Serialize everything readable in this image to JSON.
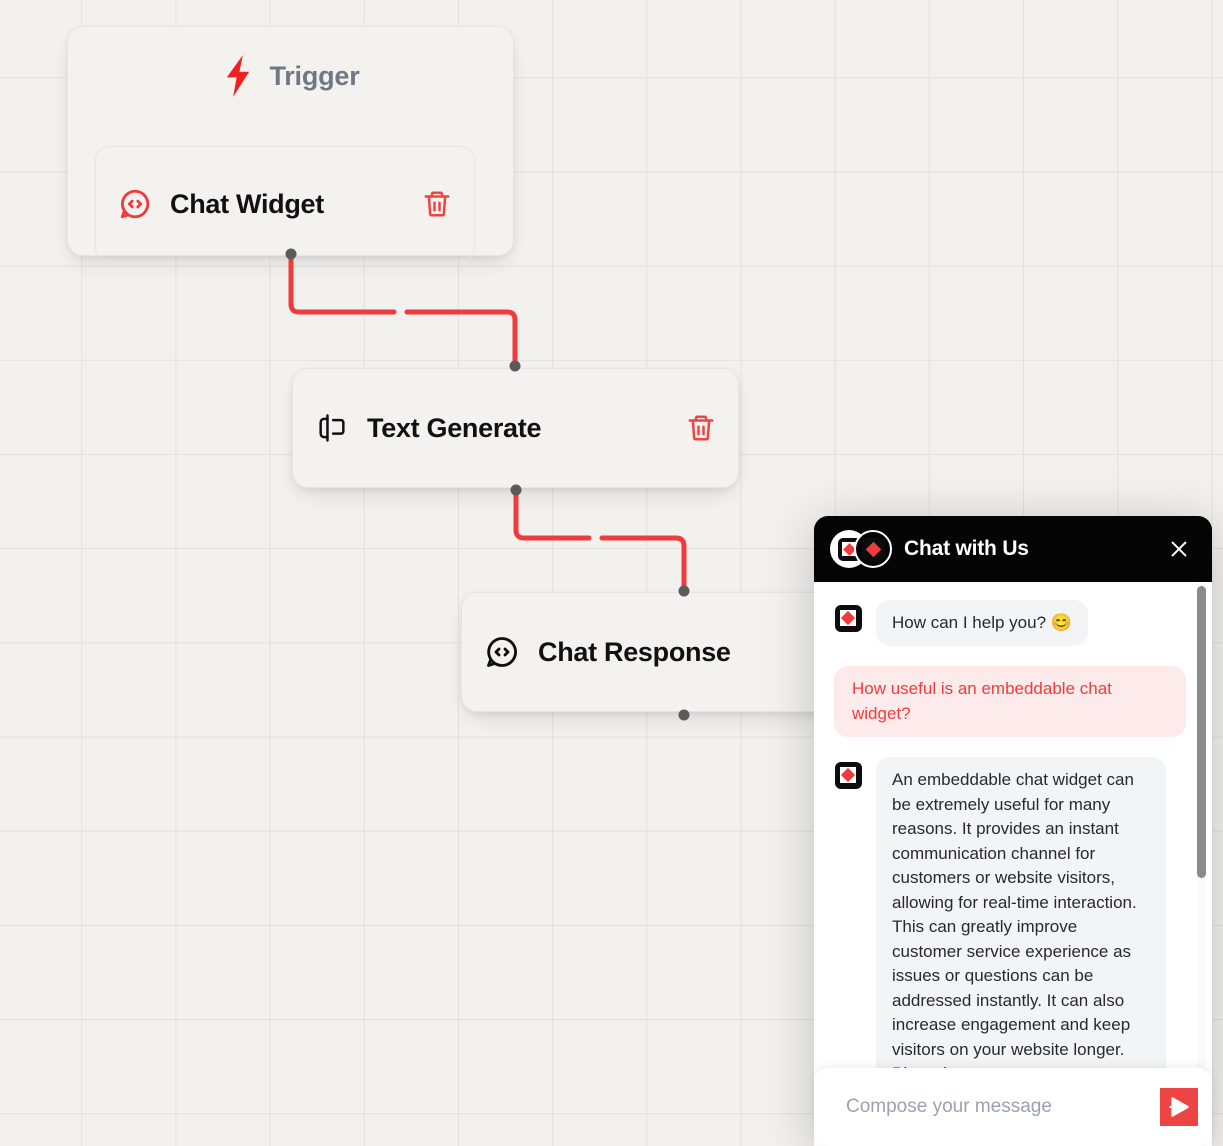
{
  "canvas": {
    "background_color": "#f2f1ee",
    "grid_color": "#e2e1dd",
    "accent_color": "#ef3b3b"
  },
  "workflow": {
    "trigger_group": {
      "label": "Trigger",
      "icon": "lightning-bolt-icon",
      "child_node": {
        "title": "Chat Widget",
        "icon": "chat-code-bubble-icon",
        "delete_label": "trash-icon"
      }
    },
    "nodes": [
      {
        "title": "Text Generate",
        "icon": "text-cursor-icon",
        "delete_label": "trash-icon"
      },
      {
        "title": "Chat Response",
        "icon": "chat-code-bubble-icon",
        "delete_label": ""
      }
    ],
    "connector_color": "#ef3b3b",
    "port_color": "#5b5b5b"
  },
  "chat_widget": {
    "header": {
      "title": "Chat with Us",
      "close_icon": "close-icon",
      "avatar_left": "brand-diamond-avatar",
      "avatar_right": "brand-diamond-avatar"
    },
    "messages": [
      {
        "role": "bot",
        "text": "How can I help you? 😊"
      },
      {
        "role": "user",
        "text": "How useful is an embeddable chat widget?"
      },
      {
        "role": "bot",
        "text": "An embeddable chat widget can be extremely useful for many reasons. It provides an instant communication channel for customers or website visitors, allowing for real-time interaction. This can greatly improve customer service experience as issues or questions can be addressed instantly. It can also increase engagement and keep visitors on your website longer. Plus, chat"
      }
    ],
    "compose": {
      "placeholder": "Compose your message",
      "value": "",
      "send_icon": "send-icon"
    }
  }
}
